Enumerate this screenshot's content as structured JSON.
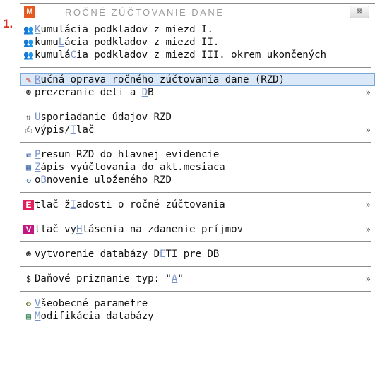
{
  "step_number": "1.",
  "window": {
    "icon_letter": "M",
    "title": "ROČNÉ ZÚČTOVANIE DANE",
    "close_glyph": "⊠"
  },
  "groups": [
    [
      {
        "pre": "",
        "acc": "K",
        "post": "umulácia podkladov z miezd I.",
        "icon": "people-money-icon",
        "glyph": "👥",
        "color": "#a8732a",
        "arrow": false
      },
      {
        "pre": "kumu",
        "acc": "L",
        "post": "ácia podkladov z miezd II.",
        "icon": "people-calc-icon",
        "glyph": "👥",
        "color": "#5a7f3a",
        "arrow": false
      },
      {
        "pre": "kumulá",
        "acc": "C",
        "post": "ia podkladov z miezd III. okrem ukončených",
        "icon": "people-list-icon",
        "glyph": "👥",
        "color": "#8a6a30",
        "arrow": false
      }
    ],
    [
      {
        "pre": "",
        "acc": "R",
        "post": "učná oprava ročného zúčtovania dane (RZD)",
        "icon": "edit-error-icon",
        "glyph": "✎",
        "color": "#c4281c",
        "arrow": false,
        "selected": true
      },
      {
        "pre": "prezeranie deti a ",
        "acc": "D",
        "post": "B",
        "icon": "children-icon",
        "glyph": "☻",
        "color": "#333333",
        "arrow": true
      }
    ],
    [
      {
        "pre": "",
        "acc": "U",
        "post": "sporiadanie údajov RZD",
        "icon": "sort-document-icon",
        "glyph": "⇅",
        "color": "#555555",
        "arrow": false
      },
      {
        "pre": "výpis/",
        "acc": "T",
        "post": "lač",
        "icon": "printer-icon",
        "glyph": "⎙",
        "color": "#555555",
        "arrow": true
      }
    ],
    [
      {
        "pre": "",
        "acc": "P",
        "post": "resun RZD do hlavnej evidencie",
        "icon": "transfer-icon",
        "glyph": "⇄",
        "color": "#3a5fa8",
        "arrow": false
      },
      {
        "pre": "",
        "acc": "Z",
        "post": "ápis vyúčtovania do akt.mesiaca",
        "icon": "spreadsheet-icon",
        "glyph": "▦",
        "color": "#3a6aa8",
        "arrow": false
      },
      {
        "pre": "o",
        "acc": "B",
        "post": "novenie uloženého RZD",
        "icon": "restore-icon",
        "glyph": "↻",
        "color": "#3a6aa8",
        "arrow": false
      }
    ],
    [
      {
        "pre": "tlač ž",
        "acc": "I",
        "post": "adosti o ročné zúčtovania",
        "icon": "form-e-icon",
        "glyph": "E",
        "color": "#e0205a",
        "arrow": true,
        "block": true
      }
    ],
    [
      {
        "pre": "tlač vy",
        "acc": "H",
        "post": "lásenia na zdanenie príjmov",
        "icon": "form-v-icon",
        "glyph": "V",
        "color": "#c01880",
        "arrow": true,
        "block": true
      }
    ],
    [
      {
        "pre": "vytvorenie databázy D",
        "acc": "E",
        "post": "TI pre DB",
        "icon": "children-database-icon",
        "glyph": "☻",
        "color": "#333333",
        "arrow": false
      }
    ],
    [
      {
        "pre": "Daňové priznanie typ: \"",
        "acc": "A",
        "post": "\"",
        "icon": "money-icon",
        "glyph": "$",
        "color": "#222222",
        "arrow": true
      }
    ],
    [
      {
        "pre": "",
        "acc": "V",
        "post": "šeobecné parametre",
        "icon": "settings-people-icon",
        "glyph": "⚙",
        "color": "#6a6a20",
        "arrow": false
      },
      {
        "pre": "",
        "acc": "M",
        "post": "odifikácia databázy",
        "icon": "database-edit-icon",
        "glyph": "▤",
        "color": "#2a7a4a",
        "arrow": false
      }
    ]
  ],
  "submenu_arrow": "»"
}
